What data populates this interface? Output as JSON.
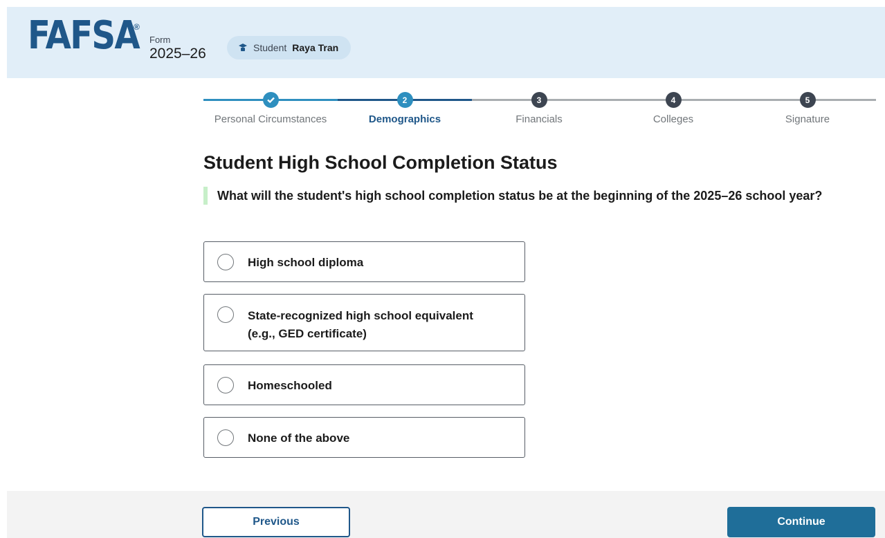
{
  "header": {
    "logo_text": "FAFSA",
    "registered_mark": "®",
    "form_label": "Form",
    "form_year": "2025–26",
    "student_role": "Student",
    "student_name": "Raya Tran"
  },
  "stepper": {
    "steps": [
      {
        "number": "",
        "label": "Personal Circumstances",
        "state": "complete"
      },
      {
        "number": "2",
        "label": "Demographics",
        "state": "active"
      },
      {
        "number": "3",
        "label": "Financials",
        "state": "upcoming"
      },
      {
        "number": "4",
        "label": "Colleges",
        "state": "upcoming"
      },
      {
        "number": "5",
        "label": "Signature",
        "state": "upcoming"
      }
    ]
  },
  "page": {
    "title": "Student High School Completion Status",
    "question": "What will the student's high school completion status be at the beginning of the 2025–26 school year?"
  },
  "options": [
    {
      "line1": "High school diploma",
      "line2": ""
    },
    {
      "line1": "State-recognized high school equivalent",
      "line2": "(e.g., GED certificate)"
    },
    {
      "line1": "Homeschooled",
      "line2": ""
    },
    {
      "line1": "None of the above",
      "line2": ""
    }
  ],
  "footer": {
    "previous_label": "Previous",
    "continue_label": "Continue"
  },
  "colors": {
    "brand": "#1f5789",
    "step_active": "#2e8fbf",
    "step_upcoming": "#3d4551",
    "header_bg": "#e1eef8",
    "accent_bar": "#c7efc9",
    "continue_bg": "#1f6e99"
  }
}
